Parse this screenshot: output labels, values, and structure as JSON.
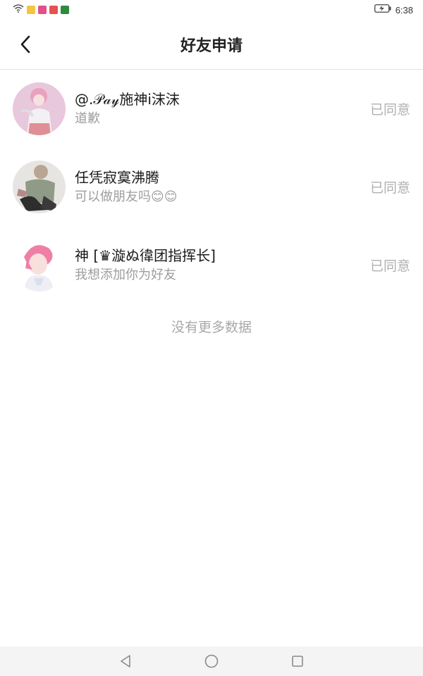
{
  "status_bar": {
    "time": "6:38",
    "app_icon_colors": [
      "#f4c542",
      "#e0508a",
      "#e65151",
      "#2f8a3e"
    ]
  },
  "header": {
    "title": "好友申请"
  },
  "requests": [
    {
      "name": "@.𝒫𝒶𝓎施神i沫沫",
      "message": "道歉",
      "status": "已同意"
    },
    {
      "name": "任凭寂寞沸腾",
      "message": "可以做朋友吗😊😊",
      "status": "已同意"
    },
    {
      "name": "神 [♛漩ぬ徫团指挥长]",
      "message": "我想添加你为好友",
      "status": "已同意"
    }
  ],
  "footer": {
    "no_more": "没有更多数据"
  }
}
